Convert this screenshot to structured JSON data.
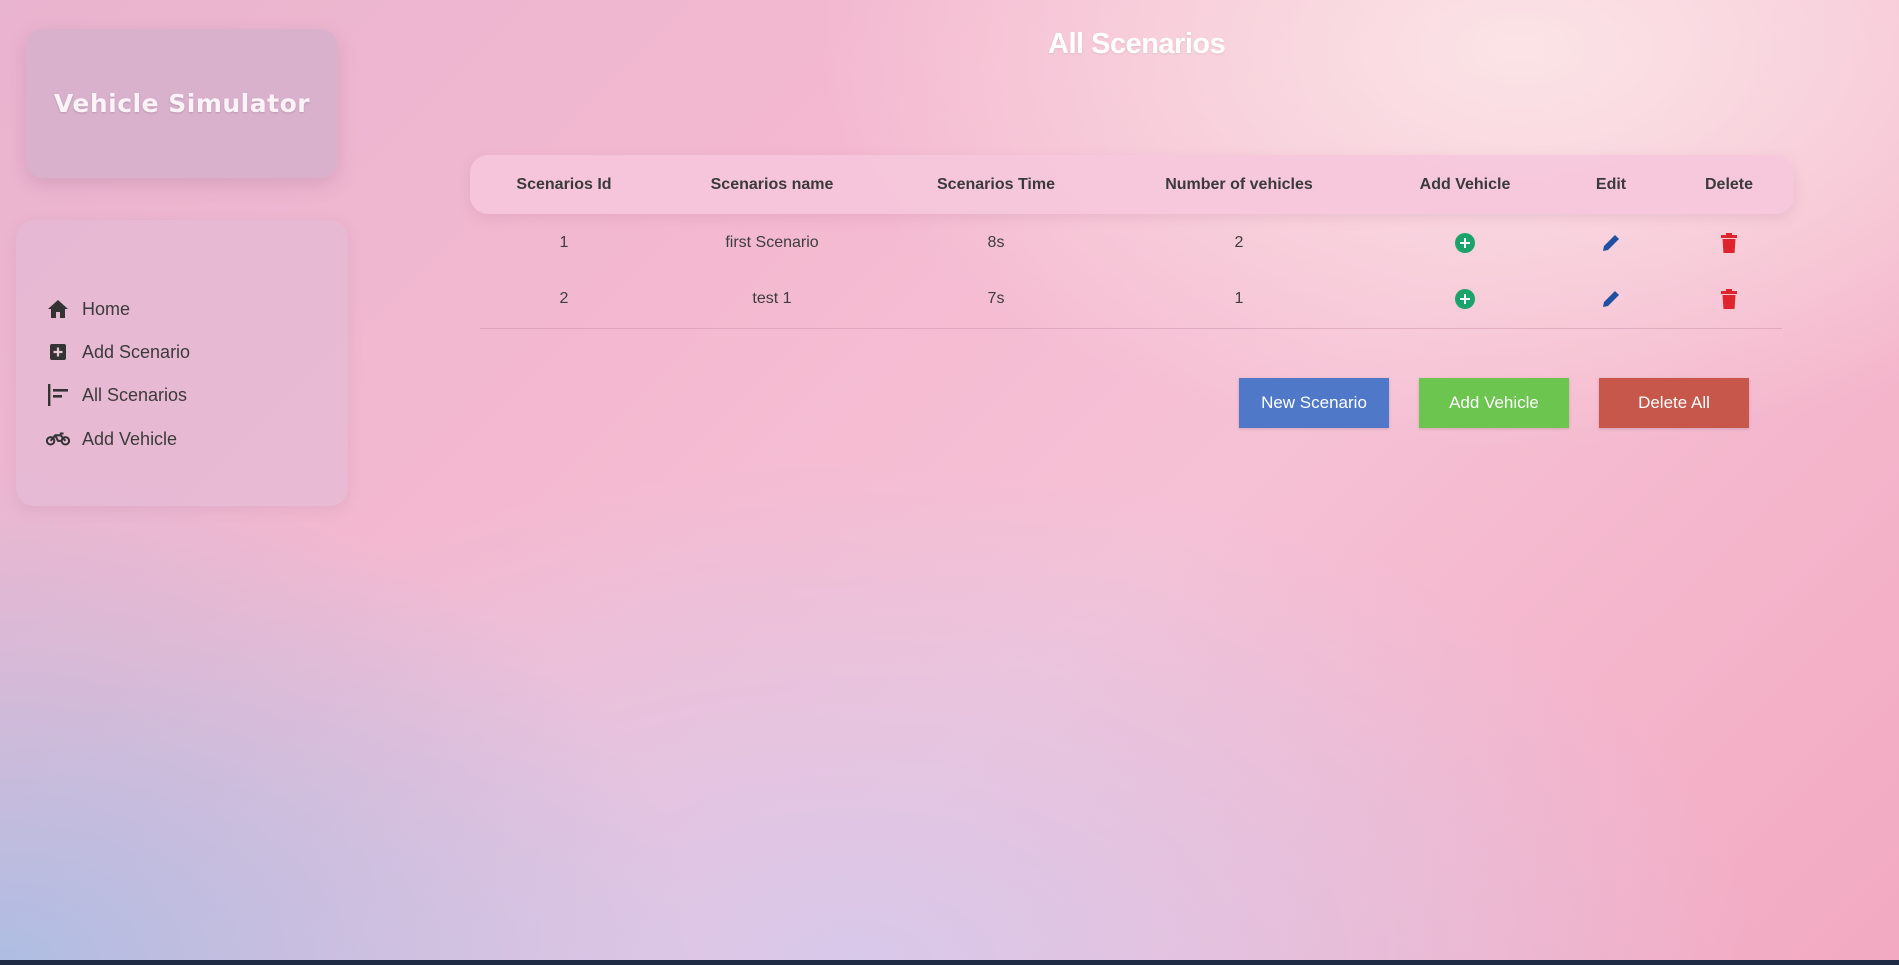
{
  "brand": {
    "title": "Vehicle Simulator"
  },
  "nav": [
    {
      "label": "Home",
      "icon": "home-icon"
    },
    {
      "label": "Add Scenario",
      "icon": "plus-square-icon"
    },
    {
      "label": "All Scenarios",
      "icon": "align-left-icon"
    },
    {
      "label": "Add Vehicle",
      "icon": "motorcycle-icon"
    }
  ],
  "page": {
    "title": "All Scenarios"
  },
  "table": {
    "headers": [
      "Scenarios Id",
      "Scenarios name",
      "Scenarios Time",
      "Number of vehicles",
      "Add Vehicle",
      "Edit",
      "Delete"
    ],
    "rows": [
      {
        "id": "1",
        "name": "first Scenario",
        "time": "8s",
        "vehicles": "2"
      },
      {
        "id": "2",
        "name": "test 1",
        "time": "7s",
        "vehicles": "1"
      }
    ],
    "icons": {
      "add": "plus-circle-icon",
      "edit": "pencil-icon",
      "delete": "trash-icon"
    }
  },
  "actions": {
    "new_scenario": "New Scenario",
    "add_vehicle": "Add Vehicle",
    "delete_all": "Delete All"
  },
  "colors": {
    "new": "#4f78c9",
    "add": "#6cc54f",
    "delete": "#c7574b",
    "add_icon": "#1aa36a",
    "edit_icon": "#1f4fa0",
    "delete_icon": "#e0242c"
  }
}
